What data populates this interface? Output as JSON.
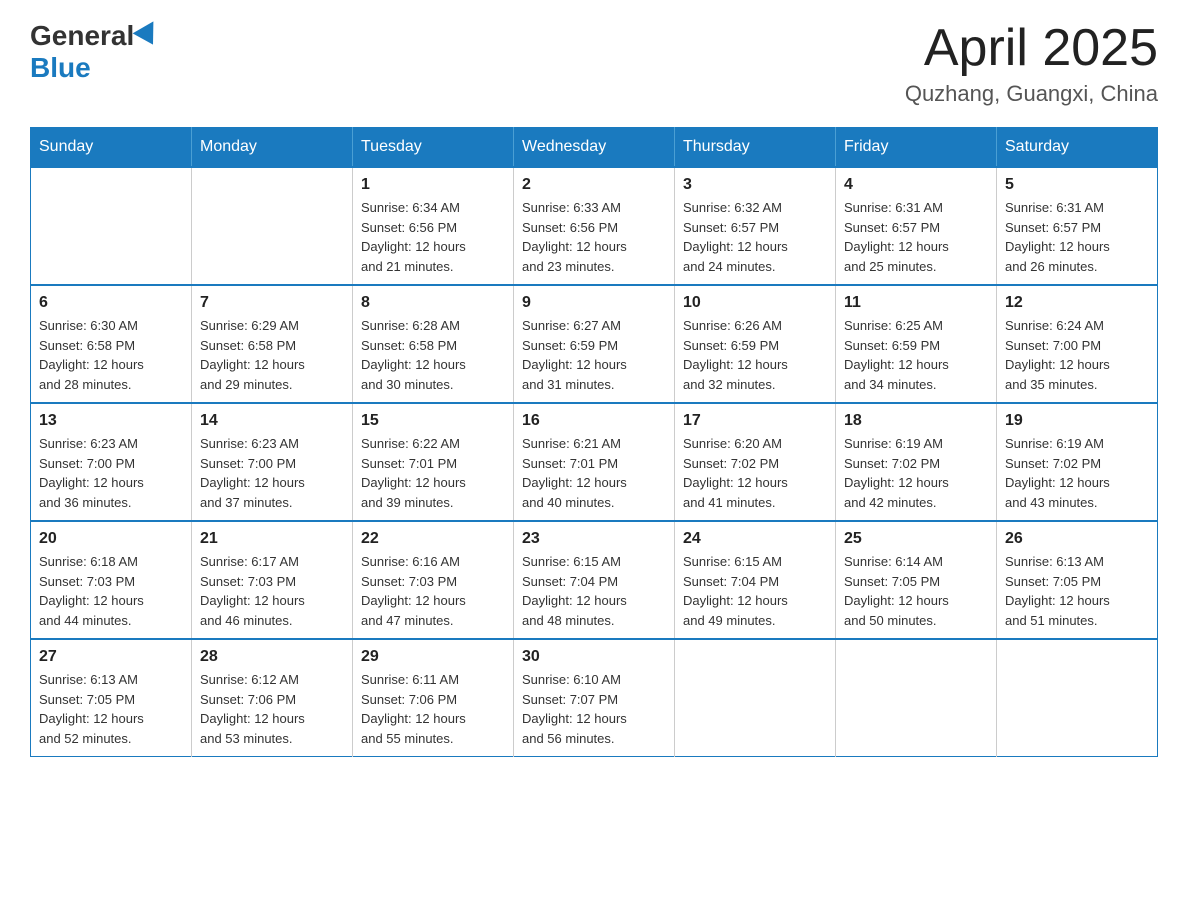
{
  "header": {
    "logo": {
      "general": "General",
      "blue": "Blue"
    },
    "title": "April 2025",
    "location": "Quzhang, Guangxi, China"
  },
  "calendar": {
    "days_of_week": [
      "Sunday",
      "Monday",
      "Tuesday",
      "Wednesday",
      "Thursday",
      "Friday",
      "Saturday"
    ],
    "weeks": [
      [
        {
          "day": "",
          "info": ""
        },
        {
          "day": "",
          "info": ""
        },
        {
          "day": "1",
          "info": "Sunrise: 6:34 AM\nSunset: 6:56 PM\nDaylight: 12 hours\nand 21 minutes."
        },
        {
          "day": "2",
          "info": "Sunrise: 6:33 AM\nSunset: 6:56 PM\nDaylight: 12 hours\nand 23 minutes."
        },
        {
          "day": "3",
          "info": "Sunrise: 6:32 AM\nSunset: 6:57 PM\nDaylight: 12 hours\nand 24 minutes."
        },
        {
          "day": "4",
          "info": "Sunrise: 6:31 AM\nSunset: 6:57 PM\nDaylight: 12 hours\nand 25 minutes."
        },
        {
          "day": "5",
          "info": "Sunrise: 6:31 AM\nSunset: 6:57 PM\nDaylight: 12 hours\nand 26 minutes."
        }
      ],
      [
        {
          "day": "6",
          "info": "Sunrise: 6:30 AM\nSunset: 6:58 PM\nDaylight: 12 hours\nand 28 minutes."
        },
        {
          "day": "7",
          "info": "Sunrise: 6:29 AM\nSunset: 6:58 PM\nDaylight: 12 hours\nand 29 minutes."
        },
        {
          "day": "8",
          "info": "Sunrise: 6:28 AM\nSunset: 6:58 PM\nDaylight: 12 hours\nand 30 minutes."
        },
        {
          "day": "9",
          "info": "Sunrise: 6:27 AM\nSunset: 6:59 PM\nDaylight: 12 hours\nand 31 minutes."
        },
        {
          "day": "10",
          "info": "Sunrise: 6:26 AM\nSunset: 6:59 PM\nDaylight: 12 hours\nand 32 minutes."
        },
        {
          "day": "11",
          "info": "Sunrise: 6:25 AM\nSunset: 6:59 PM\nDaylight: 12 hours\nand 34 minutes."
        },
        {
          "day": "12",
          "info": "Sunrise: 6:24 AM\nSunset: 7:00 PM\nDaylight: 12 hours\nand 35 minutes."
        }
      ],
      [
        {
          "day": "13",
          "info": "Sunrise: 6:23 AM\nSunset: 7:00 PM\nDaylight: 12 hours\nand 36 minutes."
        },
        {
          "day": "14",
          "info": "Sunrise: 6:23 AM\nSunset: 7:00 PM\nDaylight: 12 hours\nand 37 minutes."
        },
        {
          "day": "15",
          "info": "Sunrise: 6:22 AM\nSunset: 7:01 PM\nDaylight: 12 hours\nand 39 minutes."
        },
        {
          "day": "16",
          "info": "Sunrise: 6:21 AM\nSunset: 7:01 PM\nDaylight: 12 hours\nand 40 minutes."
        },
        {
          "day": "17",
          "info": "Sunrise: 6:20 AM\nSunset: 7:02 PM\nDaylight: 12 hours\nand 41 minutes."
        },
        {
          "day": "18",
          "info": "Sunrise: 6:19 AM\nSunset: 7:02 PM\nDaylight: 12 hours\nand 42 minutes."
        },
        {
          "day": "19",
          "info": "Sunrise: 6:19 AM\nSunset: 7:02 PM\nDaylight: 12 hours\nand 43 minutes."
        }
      ],
      [
        {
          "day": "20",
          "info": "Sunrise: 6:18 AM\nSunset: 7:03 PM\nDaylight: 12 hours\nand 44 minutes."
        },
        {
          "day": "21",
          "info": "Sunrise: 6:17 AM\nSunset: 7:03 PM\nDaylight: 12 hours\nand 46 minutes."
        },
        {
          "day": "22",
          "info": "Sunrise: 6:16 AM\nSunset: 7:03 PM\nDaylight: 12 hours\nand 47 minutes."
        },
        {
          "day": "23",
          "info": "Sunrise: 6:15 AM\nSunset: 7:04 PM\nDaylight: 12 hours\nand 48 minutes."
        },
        {
          "day": "24",
          "info": "Sunrise: 6:15 AM\nSunset: 7:04 PM\nDaylight: 12 hours\nand 49 minutes."
        },
        {
          "day": "25",
          "info": "Sunrise: 6:14 AM\nSunset: 7:05 PM\nDaylight: 12 hours\nand 50 minutes."
        },
        {
          "day": "26",
          "info": "Sunrise: 6:13 AM\nSunset: 7:05 PM\nDaylight: 12 hours\nand 51 minutes."
        }
      ],
      [
        {
          "day": "27",
          "info": "Sunrise: 6:13 AM\nSunset: 7:05 PM\nDaylight: 12 hours\nand 52 minutes."
        },
        {
          "day": "28",
          "info": "Sunrise: 6:12 AM\nSunset: 7:06 PM\nDaylight: 12 hours\nand 53 minutes."
        },
        {
          "day": "29",
          "info": "Sunrise: 6:11 AM\nSunset: 7:06 PM\nDaylight: 12 hours\nand 55 minutes."
        },
        {
          "day": "30",
          "info": "Sunrise: 6:10 AM\nSunset: 7:07 PM\nDaylight: 12 hours\nand 56 minutes."
        },
        {
          "day": "",
          "info": ""
        },
        {
          "day": "",
          "info": ""
        },
        {
          "day": "",
          "info": ""
        }
      ]
    ]
  }
}
